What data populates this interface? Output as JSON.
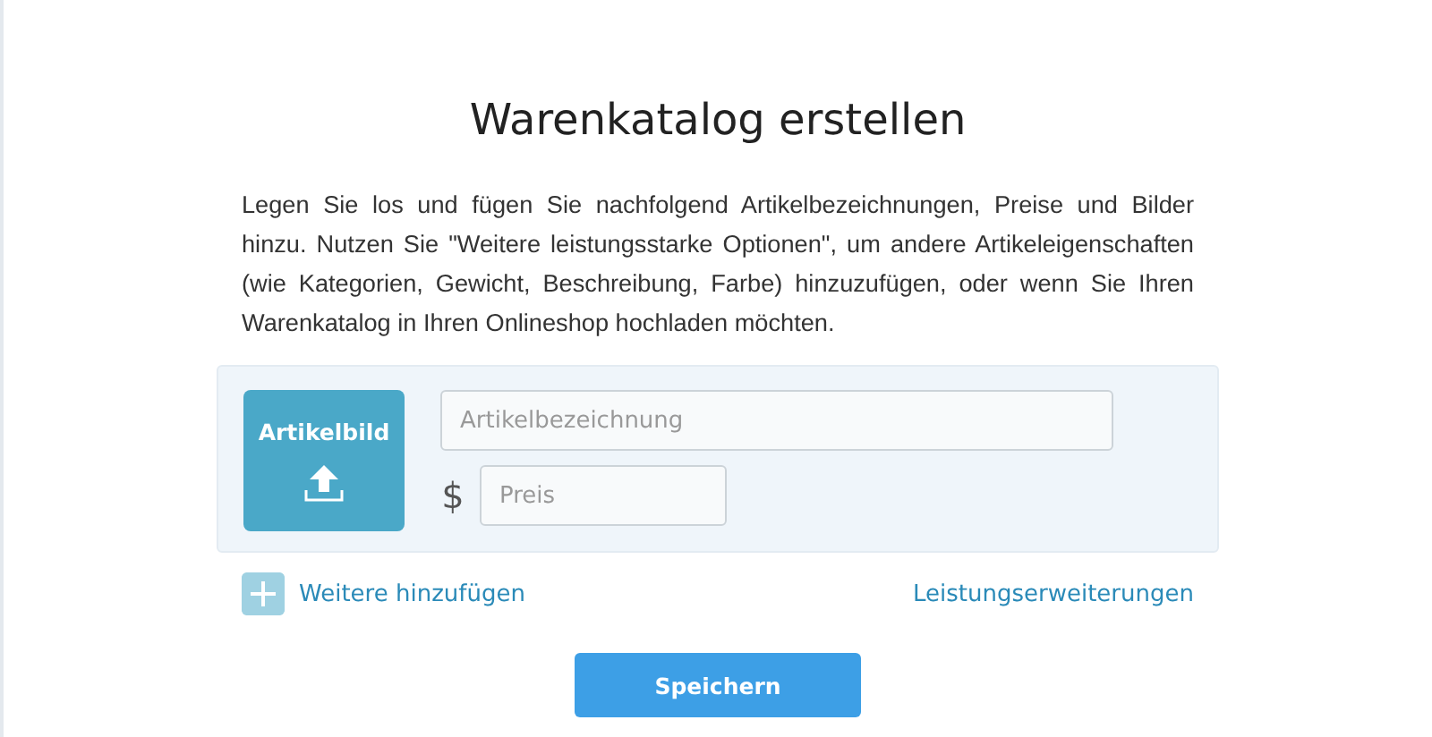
{
  "dialog": {
    "title": "Warenkatalog erstellen",
    "description": "Legen Sie los und fügen Sie nachfolgend Artikelbezeichnungen, Preise und Bilder hinzu. Nutzen Sie \"Weitere leistungsstarke Optionen\", um andere Artikeleigenschaften (wie Kategorien, Gewicht, Beschreibung, Farbe) hinzuzufügen, oder wenn Sie Ihren Warenkatalog in Ihren Onlineshop hochladen möchten.",
    "item": {
      "image_label": "Artikelbild",
      "name_placeholder": "Artikelbezeichnung",
      "currency": "$",
      "price_placeholder": "Preis"
    },
    "add_more": "Weitere hinzufügen",
    "extensions": "Leistungserweiterungen",
    "save": "Speichern"
  }
}
